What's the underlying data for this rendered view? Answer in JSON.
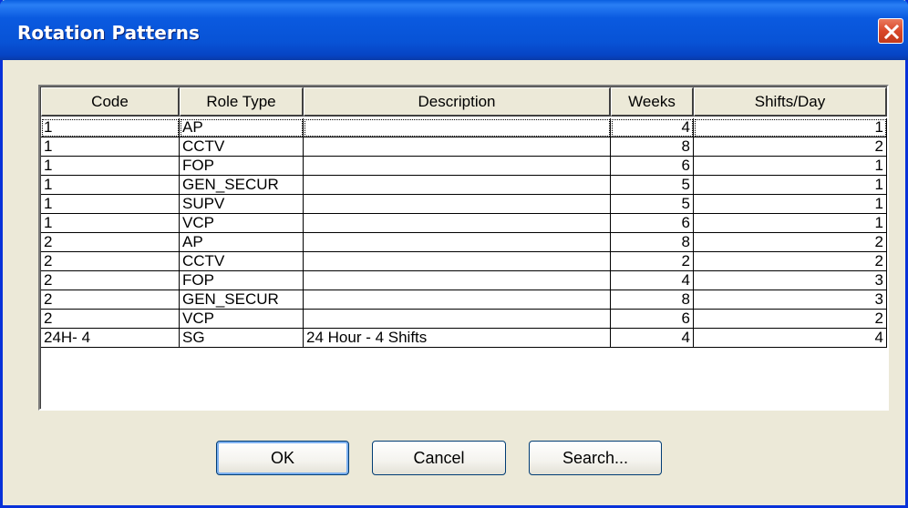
{
  "window": {
    "title": "Rotation Patterns"
  },
  "grid": {
    "columns": [
      "Code",
      "Role Type",
      "Description",
      "Weeks",
      "Shifts/Day"
    ],
    "rows": [
      {
        "code": "1",
        "role_type": "AP",
        "description": "",
        "weeks": "4",
        "shifts_per_day": "1"
      },
      {
        "code": "1",
        "role_type": "CCTV",
        "description": "",
        "weeks": "8",
        "shifts_per_day": "2"
      },
      {
        "code": "1",
        "role_type": "FOP",
        "description": "",
        "weeks": "6",
        "shifts_per_day": "1"
      },
      {
        "code": "1",
        "role_type": "GEN_SECUR",
        "description": "",
        "weeks": "5",
        "shifts_per_day": "1"
      },
      {
        "code": "1",
        "role_type": "SUPV",
        "description": "",
        "weeks": "5",
        "shifts_per_day": "1"
      },
      {
        "code": "1",
        "role_type": "VCP",
        "description": "",
        "weeks": "6",
        "shifts_per_day": "1"
      },
      {
        "code": "2",
        "role_type": "AP",
        "description": "",
        "weeks": "8",
        "shifts_per_day": "2"
      },
      {
        "code": "2",
        "role_type": "CCTV",
        "description": "",
        "weeks": "2",
        "shifts_per_day": "2"
      },
      {
        "code": "2",
        "role_type": "FOP",
        "description": "",
        "weeks": "4",
        "shifts_per_day": "3"
      },
      {
        "code": "2",
        "role_type": "GEN_SECUR",
        "description": "",
        "weeks": "8",
        "shifts_per_day": "3"
      },
      {
        "code": "2",
        "role_type": "VCP",
        "description": "",
        "weeks": "6",
        "shifts_per_day": "2"
      },
      {
        "code": "24H- 4",
        "role_type": "SG",
        "description": "24 Hour - 4 Shifts",
        "weeks": "4",
        "shifts_per_day": "4"
      }
    ]
  },
  "buttons": {
    "ok": "OK",
    "cancel": "Cancel",
    "search": "Search..."
  },
  "icons": {
    "close": "close-icon"
  },
  "colors": {
    "titlebar": "#0853d6",
    "dialog_bg": "#ece9d8",
    "close_button": "#d9482a"
  }
}
